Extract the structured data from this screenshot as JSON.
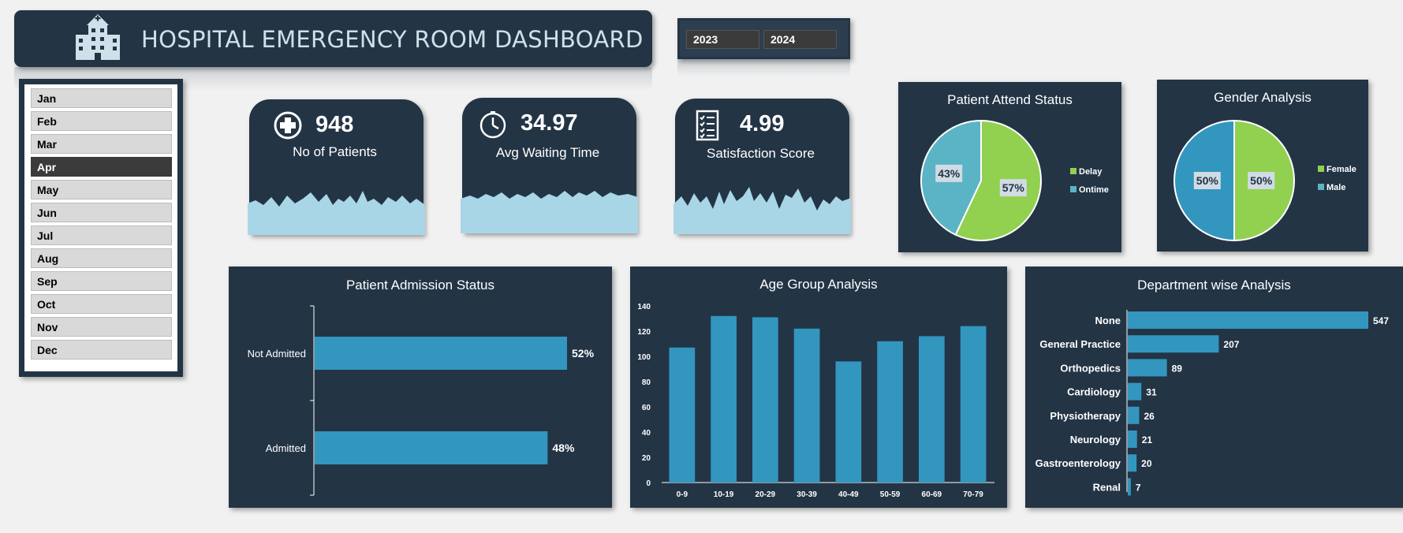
{
  "header": {
    "title": "HOSPITAL EMERGENCY ROOM DASHBOARD",
    "icon": "hospital-icon"
  },
  "year_slicer": {
    "options": [
      "2023",
      "2024"
    ]
  },
  "month_slicer": {
    "options": [
      "Jan",
      "Feb",
      "Mar",
      "Apr",
      "May",
      "Jun",
      "Jul",
      "Aug",
      "Sep",
      "Oct",
      "Nov",
      "Dec"
    ],
    "selected": "Apr"
  },
  "kpis": [
    {
      "value": "948",
      "label": "No of Patients",
      "icon": "medical-cross-icon"
    },
    {
      "value": "34.97",
      "label": "Avg Waiting Time",
      "icon": "clock-icon"
    },
    {
      "value": "4.99",
      "label": "Satisfaction Score",
      "icon": "checklist-icon"
    }
  ],
  "colors": {
    "panel": "#233445",
    "green": "#92d050",
    "teal": "#5ab4c5",
    "blue": "#3296bf",
    "light_blue": "#a9d6e7"
  },
  "chart_data": [
    {
      "id": "attend",
      "type": "pie",
      "title": "Patient Attend Status",
      "slices": [
        {
          "name": "Delay",
          "value": 57,
          "label": "57%"
        },
        {
          "name": "Ontime",
          "value": 43,
          "label": "43%"
        }
      ],
      "legend": "right"
    },
    {
      "id": "gender",
      "type": "pie",
      "title": "Gender Analysis",
      "slices": [
        {
          "name": "Female",
          "value": 50,
          "label": "50%"
        },
        {
          "name": "Male",
          "value": 50,
          "label": "50%"
        }
      ],
      "legend": "right"
    },
    {
      "id": "admission",
      "type": "bar",
      "orientation": "horizontal",
      "title": "Patient  Admission Status",
      "categories": [
        "Not Admitted",
        "Admitted"
      ],
      "values": [
        52,
        48
      ],
      "labels": [
        "52%",
        "48%"
      ]
    },
    {
      "id": "age",
      "type": "bar",
      "title": "Age Group Analysis",
      "categories": [
        "0-9",
        "10-19",
        "20-29",
        "30-39",
        "40-49",
        "50-59",
        "60-69",
        "70-79"
      ],
      "values": [
        107,
        132,
        131,
        122,
        96,
        112,
        116,
        124
      ],
      "yticks": [
        "0",
        "20",
        "40",
        "60",
        "80",
        "100",
        "120",
        "140"
      ],
      "ylim": [
        0,
        140
      ]
    },
    {
      "id": "dept",
      "type": "bar",
      "orientation": "horizontal",
      "title": "Department wise Analysis",
      "categories": [
        "None",
        "General Practice",
        "Orthopedics",
        "Cardiology",
        "Physiotherapy",
        "Neurology",
        "Gastroenterology",
        "Renal"
      ],
      "values": [
        547,
        207,
        89,
        31,
        26,
        21,
        20,
        7
      ],
      "labels": [
        "547",
        "207",
        "89",
        "31",
        "26",
        "21",
        "20",
        "7"
      ]
    }
  ]
}
